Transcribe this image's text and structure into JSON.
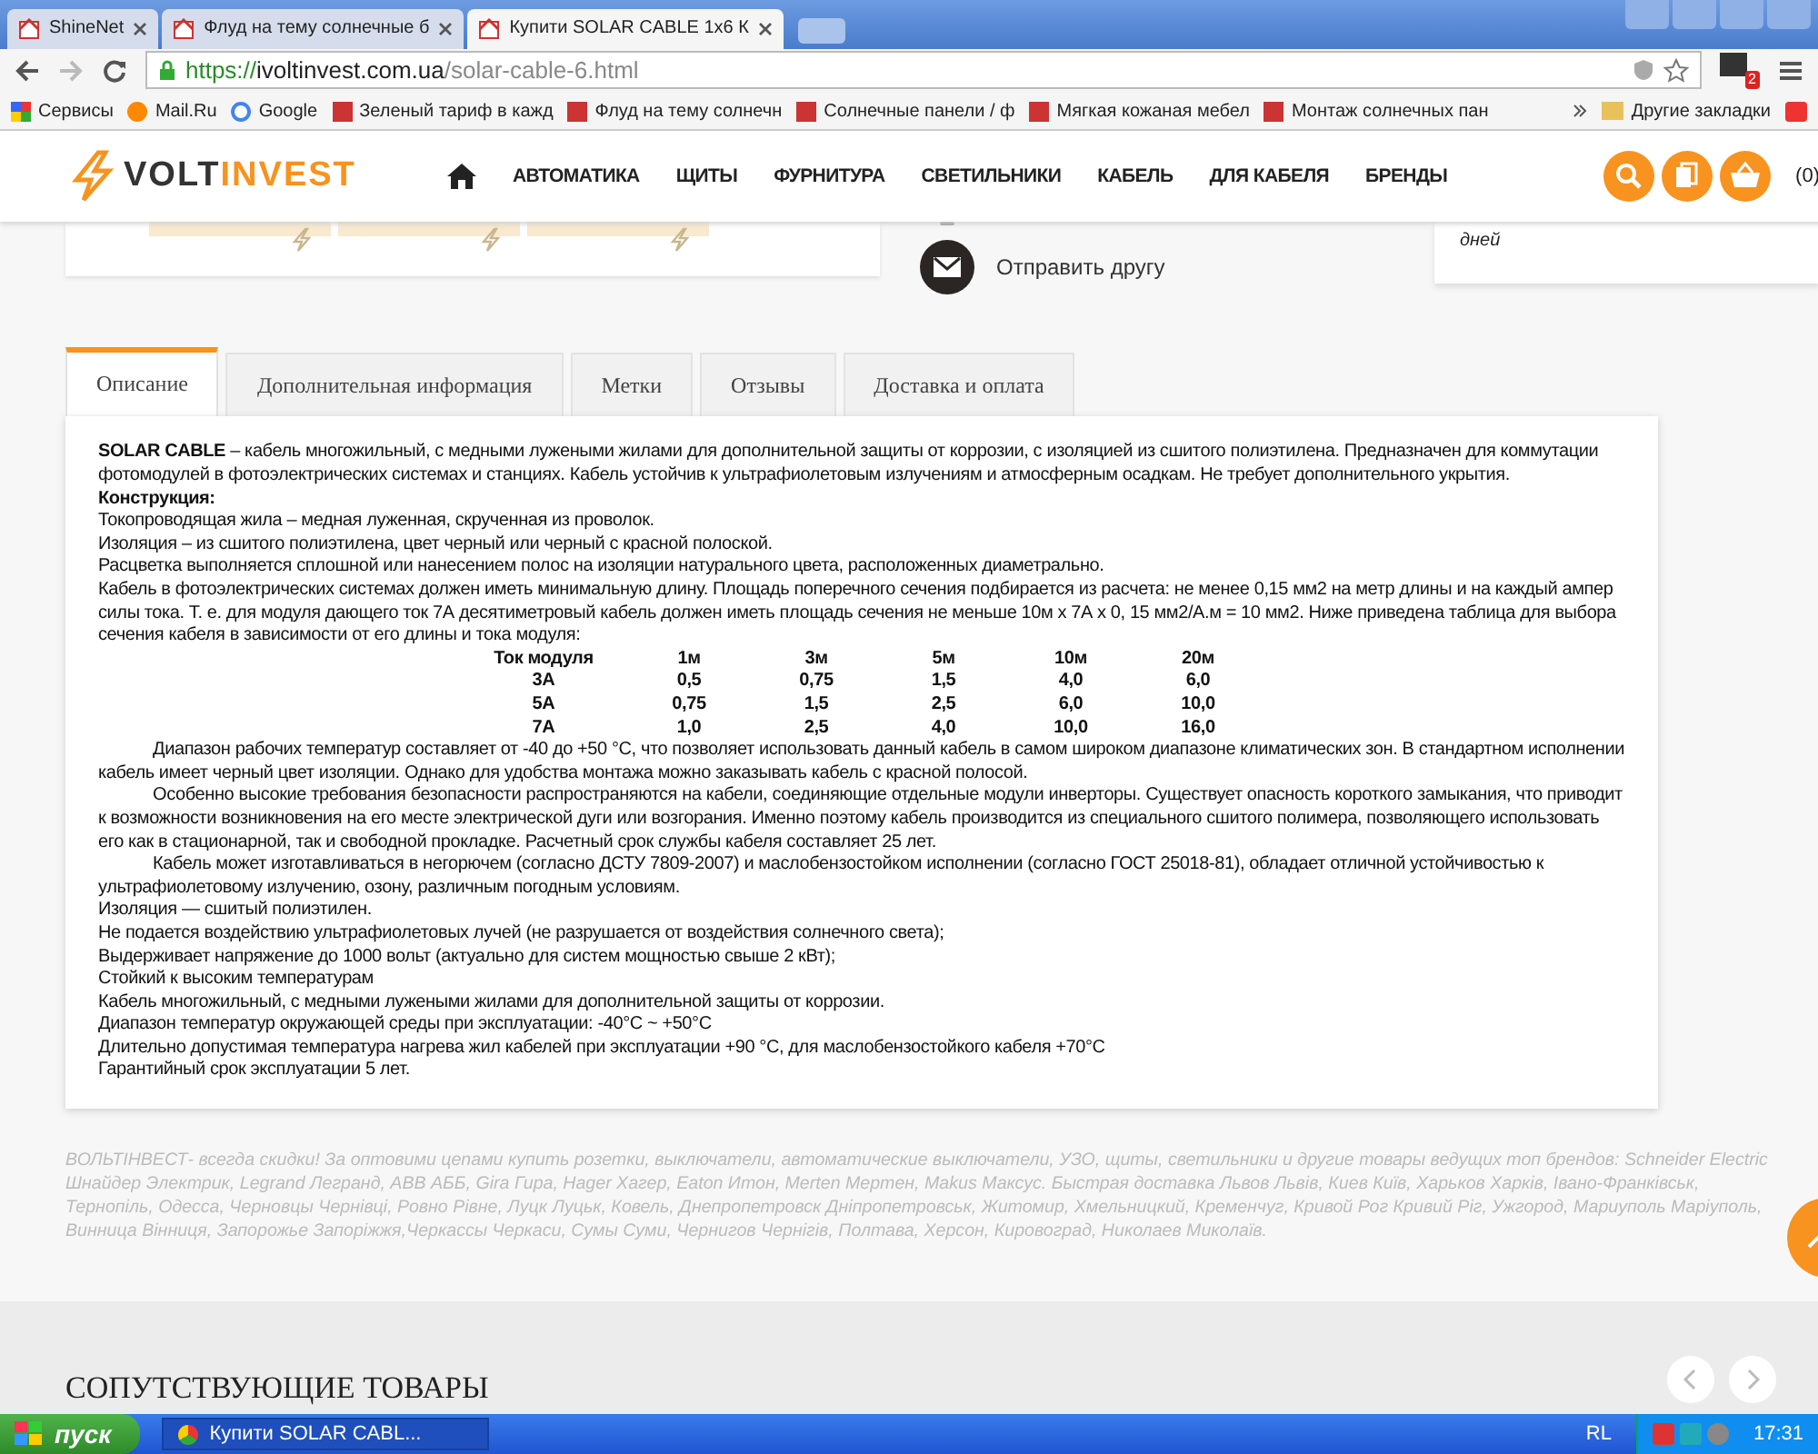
{
  "browser": {
    "tabs": [
      {
        "title": "ShineNet",
        "selected": false
      },
      {
        "title": "Флуд на тему солнечные б",
        "selected": false
      },
      {
        "title": "Купити SOLAR CABLE 1x6 К",
        "selected": true
      }
    ],
    "address": {
      "scheme": "https://",
      "host": "ivoltinvest.com.ua",
      "path": "/solar-cable-6.html"
    },
    "extension_badge": "2",
    "bookmarks": [
      "Сервисы",
      "Mail.Ru",
      "Google",
      "Зеленый тариф в кажд",
      "Флуд на тему солнечн",
      "Солнечные панели / ф",
      "Мягкая кожаная мебел",
      "Монтаж солнечных пан"
    ],
    "other_bookmarks": "Другие закладки"
  },
  "header": {
    "logo": {
      "part1": "VOLT",
      "part2": "INVEST"
    },
    "nav": [
      "АВТОМАТИКА",
      "ЩИТЫ",
      "ФУРНИТУРА",
      "СВЕТИЛЬНИКИ",
      "КАБЕЛЬ",
      "ДЛЯ КАБЕЛЯ",
      "БРЕНДЫ"
    ],
    "cart_count": "(0)"
  },
  "product": {
    "send_to_friend": "Отправить другу",
    "delivery_note": "дней"
  },
  "tabs": [
    {
      "label": "Описание",
      "selected": true
    },
    {
      "label": "Дополнительная информация",
      "selected": false
    },
    {
      "label": "Метки",
      "selected": false
    },
    {
      "label": "Отзывы",
      "selected": false
    },
    {
      "label": "Доставка и оплата",
      "selected": false
    }
  ],
  "description": {
    "intro": [
      {
        "kind": "text",
        "text": "**SOLAR CABLE** – кабель многожильный, с медными лужеными жилами для дополнительной защиты от коррозии, с изоляцией из сшитого полиэтилена. Предназначен для коммутации фотомодулей в фотоэлектрических системах и станциях. Кабель устойчив к ультрафиолетовым излучениям и атмосферным осадкам. Не требует дополнительного укрытия."
      },
      {
        "kind": "heading",
        "text": "Конструкция:"
      },
      {
        "kind": "text",
        "text": "Токопроводящая жила – медная луженная, скрученная из проволок."
      },
      {
        "kind": "text",
        "text": "Изоляция – из сшитого полиэтилена, цвет черный или черный с красной полоской."
      },
      {
        "kind": "text",
        "text": "Расцветка выполняется сплошной или нанесением полос на изоляции натурального цвета, расположенных диаметрально."
      },
      {
        "kind": "text",
        "text": "Кабель в фотоэлектрических системах должен иметь минимальную длину. Площадь поперечного сечения подбирается из расчета: не менее 0,15 мм2 на метр длины и на каждый ампер силы тока. Т. е. для модуля дающего ток 7А десятиметровый кабель должен иметь площадь сечения не меньше 10м х 7А х 0, 15 мм2/А.м = 10 мм2. Ниже приведена таблица для выбора сечения кабеля в зависимости от его длины и тока модуля:"
      }
    ],
    "table": {
      "columns": [
        "Ток модуля",
        "1м",
        "3м",
        "5м",
        "10м",
        "20м"
      ],
      "rows": [
        [
          "3А",
          "0,5",
          "0,75",
          "1,5",
          "4,0",
          "6,0"
        ],
        [
          "5А",
          "0,75",
          "1,5",
          "2,5",
          "6,0",
          "10,0"
        ],
        [
          "7А",
          "1,0",
          "2,5",
          "4,0",
          "10,0",
          "16,0"
        ]
      ]
    },
    "details": [
      {
        "indented": true,
        "text": "Диапазон рабочих температур составляет от -40 до +50 °С, что позволяет использовать данный кабель в самом широком диапазоне климатических зон. В стандартном исполнении кабель имеет черный цвет изоляции. Однако для удобства монтажа можно заказывать кабель с красной полосой."
      },
      {
        "indented": true,
        "text": "Особенно высокие требования безопасности распространяются на кабели, соединяющие отдельные модули инверторы. Существует опасность короткого замыкания, что приводит к возможности возникновения на его месте электрической дуги или возгорания. Именно поэтому кабель производится из специального сшитого полимера, позволяющего использовать его как в стационарной, так и свободной прокладке. Расчетный срок службы кабеля составляет 25 лет."
      },
      {
        "indented": true,
        "text": "Кабель может изготавливаться в негорючем (согласно ДСТУ 7809-2007) и маслобензостойком исполнении (согласно ГОСТ 25018-81), обладает отличной устойчивостью к ультрафиолетовому излучению, озону, различным погодным условиям."
      },
      {
        "indented": false,
        "text": "Изоляция — сшитый полиэтилен."
      },
      {
        "indented": false,
        "text": "Не подается воздействию ультрафиолетовых лучей (не разрушается от воздействия солнечного света);"
      },
      {
        "indented": false,
        "text": "Выдерживает напряжение до 1000 вольт (актуально для систем мощностью свыше 2 кВт);"
      },
      {
        "indented": false,
        "text": "Стойкий к высоким температурам"
      },
      {
        "indented": false,
        "text": "Кабель многожильный, с медными лужеными жилами для дополнительной защиты от коррозии."
      },
      {
        "indented": false,
        "text": "Диапазон температур окружающей среды при  эксплуатации:        -40°С ~ +50°С"
      },
      {
        "indented": false,
        "text": "Длительно допустимая температура нагрева жил кабелей при эксплуатации +90 °С, для маслобензостойкого кабеля +70°С"
      },
      {
        "indented": false,
        "text": "Гарантийный срок эксплуатации 5 лет."
      }
    ]
  },
  "seo_text": "ВОЛЬТІНВЕСТ- всегда скидки! За оптовими цenами купить розетки, выключатели, автоматические выключатели, УЗО, щиты, светильники и другие товары ведущих топ брендов: Schneider Electric Шнайдер Электрик, Legrand Легранд, ABB АББ, Gira Гира, Hager Хагер, Eaton Итон, Merten Мертен, Makus Максус. Быстрая доставка Львов Львів, Киев Київ, Харьков Харків, Івано-Франківськ, Тернопіль, Одесса, Черновцы Чернівці, Ровно Рівне, Луцк Луцьк, Ковель, Днепропетровск Дніпропетровськ, Житомир, Хмельницкий, Кременчуг, Кривой Рог Кривий Ріг, Ужгород, Мариуполь Маріуполь, Винница Вінниця, Запорожье Запоріжжя,Черкассы Черкаси, Сумы Суми, Чернигов Чернігів, Полтава, Херсон, Кировоград, Николаев Миколаїв.",
  "related_title": "СОПУТСТВУЮЩИЕ ТОВАРЫ",
  "taskbar": {
    "start": "пуск",
    "window": "Купити SOLAR CABL...",
    "language": "RL",
    "clock": "17:31"
  }
}
